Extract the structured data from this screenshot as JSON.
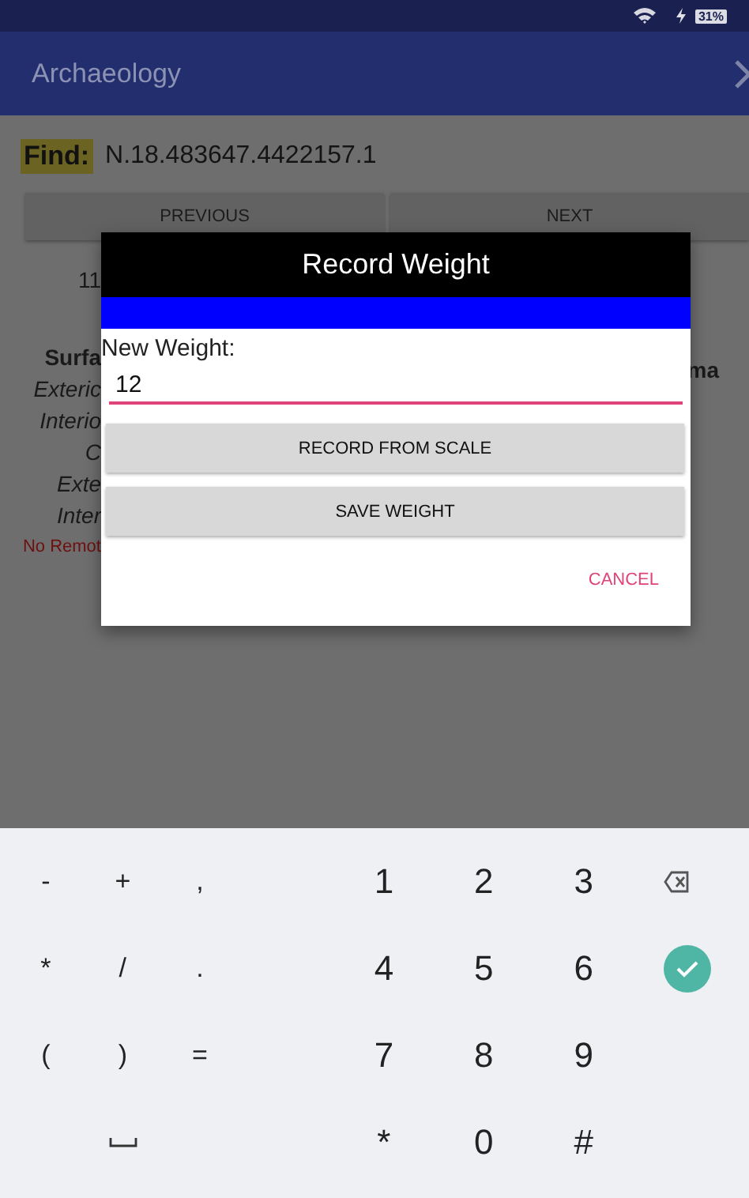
{
  "status_bar": {
    "battery": "31%"
  },
  "app_bar": {
    "title": "Archaeology"
  },
  "find": {
    "label": "Find:",
    "value": "N.18.483647.4422157.1"
  },
  "nav_buttons": [
    "PREVIOUS",
    "NEXT"
  ],
  "background_texts": [
    {
      "text": "11",
      "kind": "plain"
    },
    {
      "text": "Surfa",
      "kind": "bold"
    },
    {
      "text": "Exteric",
      "kind": "italic"
    },
    {
      "text": "Interio",
      "kind": "italic"
    },
    {
      "text": "C",
      "kind": "italic"
    },
    {
      "text": "Exte",
      "kind": "italic"
    },
    {
      "text": "Inter",
      "kind": "italic"
    },
    {
      "text": "No Remot",
      "kind": "warning"
    }
  ],
  "background_right_text": "ma",
  "dialog": {
    "title": "Record Weight",
    "field_label": "New Weight:",
    "value": "12",
    "buttons": [
      "RECORD FROM SCALE",
      "SAVE WEIGHT"
    ],
    "cancel": "CANCEL"
  },
  "keyboard": {
    "rows": [
      {
        "symbols": [
          {
            "kind": "char",
            "label": "-"
          },
          {
            "kind": "char",
            "label": "+"
          },
          {
            "kind": "char",
            "label": ","
          }
        ],
        "digits": [
          "1",
          "2",
          "3"
        ],
        "action": {
          "kind": "backspace"
        }
      },
      {
        "symbols": [
          {
            "kind": "char",
            "label": "*"
          },
          {
            "kind": "char",
            "label": "/"
          },
          {
            "kind": "char",
            "label": "."
          }
        ],
        "digits": [
          "4",
          "5",
          "6"
        ],
        "action": {
          "kind": "enter"
        }
      },
      {
        "symbols": [
          {
            "kind": "char",
            "label": "("
          },
          {
            "kind": "char",
            "label": ")"
          },
          {
            "kind": "char",
            "label": "="
          }
        ],
        "digits": [
          "7",
          "8",
          "9"
        ]
      },
      {
        "symbols": [
          {
            "kind": "gap"
          },
          {
            "kind": "space"
          },
          {
            "kind": "gap"
          }
        ],
        "digits": [
          "*",
          "0",
          "#"
        ]
      }
    ]
  }
}
